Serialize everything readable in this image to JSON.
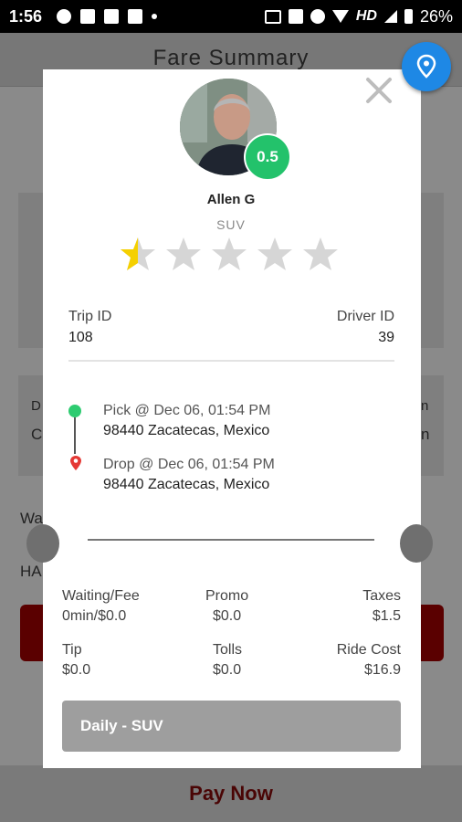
{
  "status_bar": {
    "time": "1:56",
    "network": "HD",
    "battery": "26%"
  },
  "background": {
    "title": "Fare Summary",
    "partial_labels": [
      "D",
      "C",
      "n",
      "n",
      "Wa",
      "HA"
    ],
    "pay_now": "Pay Now"
  },
  "driver": {
    "name": "Allen G",
    "car_type": "SUV",
    "rating_badge": "0.5",
    "rating": 0.5,
    "max_rating": 5
  },
  "trip": {
    "trip_id_label": "Trip ID",
    "trip_id": "108",
    "driver_id_label": "Driver ID",
    "driver_id": "39"
  },
  "locations": {
    "pick_label": "Pick @ Dec 06, 01:54 PM",
    "pick_address": "98440 Zacatecas, Mexico",
    "drop_label": "Drop @ Dec 06, 01:54 PM",
    "drop_address": "98440 Zacatecas, Mexico"
  },
  "fare": {
    "waiting_label": "Waiting/Fee",
    "waiting_value": "0min/$0.0",
    "promo_label": "Promo",
    "promo_value": "$0.0",
    "taxes_label": "Taxes",
    "taxes_value": "$1.5",
    "tip_label": "Tip",
    "tip_value": "$0.0",
    "tolls_label": "Tolls",
    "tolls_value": "$0.0",
    "ride_cost_label": "Ride Cost",
    "ride_cost_value": "$16.9"
  },
  "plan_button": "Daily - SUV",
  "colors": {
    "accent_green": "#23c26b",
    "fab_blue": "#1e88e5",
    "star_yellow": "#f5d000",
    "star_grey": "#d6d6d6"
  }
}
